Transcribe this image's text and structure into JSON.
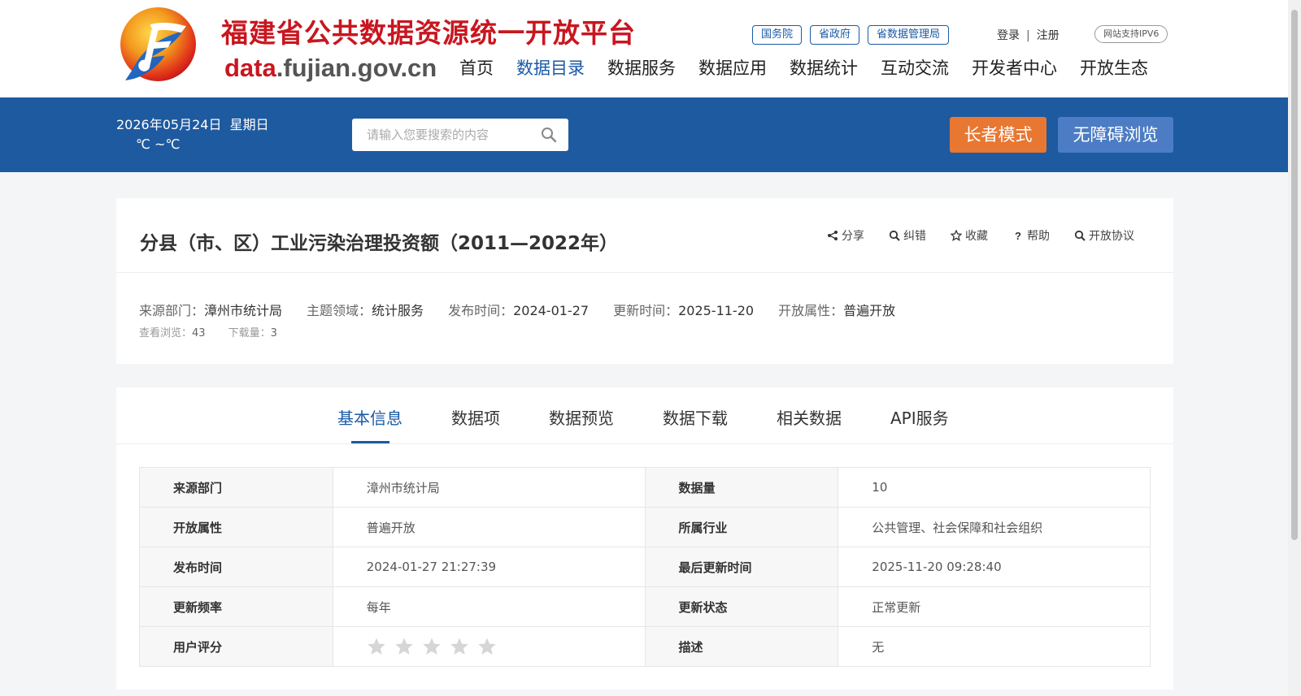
{
  "header": {
    "site_title": "福建省公共数据资源统一开放平台",
    "domain_prefix": "data",
    "domain_rest": ".fujian.gov.cn",
    "gov_links": [
      "国务院",
      "省政府",
      "省数据管理局"
    ],
    "login": "登录",
    "separator": "|",
    "register": "注册",
    "ipv6": "网站支持IPV6",
    "nav": [
      "首页",
      "数据目录",
      "数据服务",
      "数据应用",
      "数据统计",
      "互动交流",
      "开发者中心",
      "开放生态"
    ],
    "active_nav": "数据目录"
  },
  "bar": {
    "date": "2026年05月24日",
    "weekday": "星期日",
    "temperature": "℃ ~℃",
    "search_placeholder": "请输入您要搜索的内容",
    "elder_mode": "长者模式",
    "accessible": "无障碍浏览"
  },
  "dataset": {
    "title": "分县（市、区）工业污染治理投资额（2011—2022年）",
    "actions": [
      {
        "label": "分享",
        "icon": "share-icon"
      },
      {
        "label": "纠错",
        "icon": "search-icon"
      },
      {
        "label": "收藏",
        "icon": "star-icon"
      },
      {
        "label": "帮助",
        "icon": "question-icon"
      },
      {
        "label": "开放协议",
        "icon": "search-icon"
      }
    ],
    "meta": {
      "source_label": "来源部门：",
      "source": "漳州市统计局",
      "topic_label": "主题领域：",
      "topic": "统计服务",
      "publish_label": "发布时间：",
      "publish": "2024-01-27",
      "update_label": "更新时间：",
      "update": "2025-11-20",
      "open_label": "开放属性：",
      "open": "普遍开放"
    },
    "stats": {
      "views_label": "查看浏览：",
      "views": "43",
      "downloads_label": "下载量：",
      "downloads": "3"
    }
  },
  "tabs": [
    "基本信息",
    "数据项",
    "数据预览",
    "数据下载",
    "相关数据",
    "API服务"
  ],
  "active_tab": "基本信息",
  "info_table": {
    "rows": [
      {
        "k1": "来源部门",
        "v1": "漳州市统计局",
        "k2": "数据量",
        "v2": "10"
      },
      {
        "k1": "开放属性",
        "v1": "普遍开放",
        "k2": "所属行业",
        "v2": "公共管理、社会保障和社会组织"
      },
      {
        "k1": "发布时间",
        "v1": "2024-01-27 21:27:39",
        "k2": "最后更新时间",
        "v2": "2025-11-20 09:28:40"
      },
      {
        "k1": "更新频率",
        "v1": "每年",
        "k2": "更新状态",
        "v2": "正常更新"
      },
      {
        "k1": "用户评分",
        "v1": "",
        "k2": "描述",
        "v2": "无"
      }
    ],
    "rating": 0,
    "rating_max": 5
  },
  "colors": {
    "primary": "#1e5aa0",
    "brand_red": "#c9161f",
    "elder_button": "#e87732",
    "accessible_button": "#4c7dc4"
  }
}
